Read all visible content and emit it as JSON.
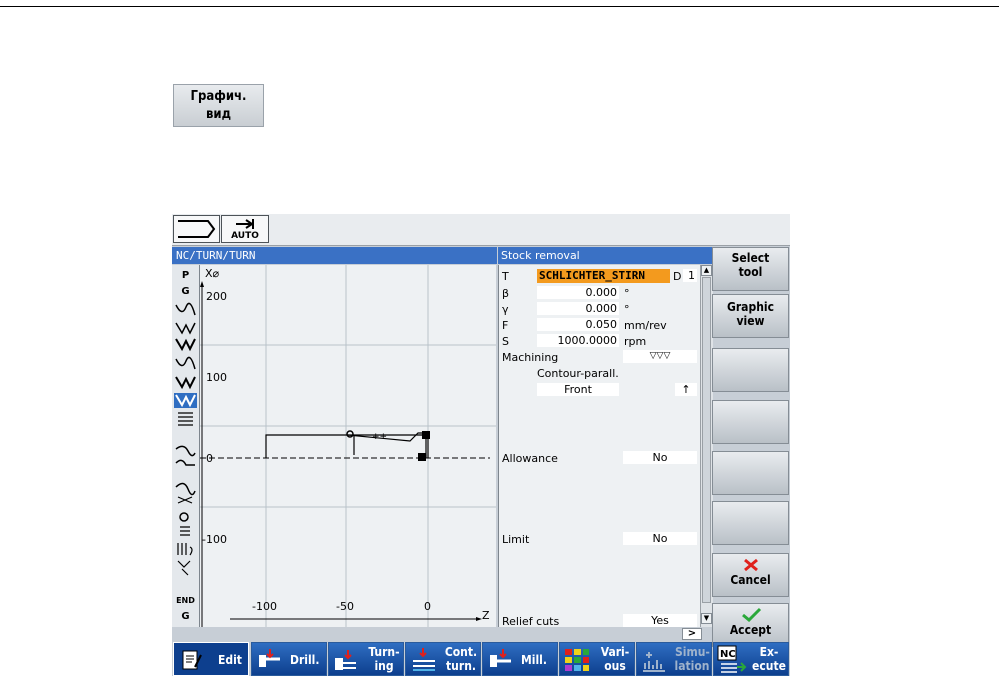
{
  "doc_button": {
    "line1": "Графич.",
    "line2": "вид"
  },
  "status_bar": {
    "mode_label": "AUTO"
  },
  "editor": {
    "path_title": "NC/TURN/TURN",
    "param_title": "Stock removal"
  },
  "left_icons": [
    "P",
    "G",
    "G",
    "END"
  ],
  "plot": {
    "x_axis_label": "X⌀",
    "z_axis_label": "Z",
    "y_ticks": [
      "200",
      "100",
      "0",
      "-100"
    ],
    "z_ticks": [
      "-100",
      "-50",
      "0"
    ]
  },
  "params": {
    "t_label": "T",
    "t_value": "SCHLICHTER_STIRN",
    "d_label": "D",
    "d_value": "1",
    "beta_label": "β",
    "beta_value": "0.000",
    "beta_unit": "°",
    "gamma_label": "γ",
    "gamma_value": "0.000",
    "gamma_unit": "°",
    "f_label": "F",
    "f_value": "0.050",
    "f_unit": "mm/rev",
    "s_label": "S",
    "s_value": "1000.0000",
    "s_unit": "rpm",
    "machining_label": "Machining",
    "machining_value": "▽▽▽",
    "contour_label": "Contour-parall.",
    "contour_value": "Front",
    "arrow_value": "↑",
    "allowance_label": "Allowance",
    "allowance_value": "No",
    "limit_label": "Limit",
    "limit_value": "No",
    "relief_label": "Relief cuts",
    "relief_value": "Yes",
    "more_indicator": ">"
  },
  "vertical_softkeys": [
    {
      "line1": "Select",
      "line2": "tool"
    },
    {
      "line1": "Graphic",
      "line2": "view"
    },
    {
      "line1": "",
      "line2": ""
    },
    {
      "line1": "",
      "line2": ""
    },
    {
      "line1": "",
      "line2": ""
    },
    {
      "line1": "",
      "line2": ""
    },
    {
      "line1": "Cancel",
      "line2": ""
    },
    {
      "line1": "Accept",
      "line2": ""
    }
  ],
  "horizontal_softkeys": [
    {
      "line1": "Edit",
      "line2": ""
    },
    {
      "line1": "Drill.",
      "line2": ""
    },
    {
      "line1": "Turn-",
      "line2": "ing"
    },
    {
      "line1": "Cont.",
      "line2": "turn."
    },
    {
      "line1": "Mill.",
      "line2": ""
    },
    {
      "line1": "Vari-",
      "line2": "ous"
    },
    {
      "line1": "Simu-",
      "line2": "lation"
    },
    {
      "line1": "Ex-",
      "line2": "ecute"
    }
  ],
  "colors": {
    "title_blue": "#3a71c5",
    "tool_orange": "#f39a1e",
    "softkey_blue": "#1550a8",
    "cancel_red": "#e0201b",
    "accept_green": "#2aa83a"
  }
}
